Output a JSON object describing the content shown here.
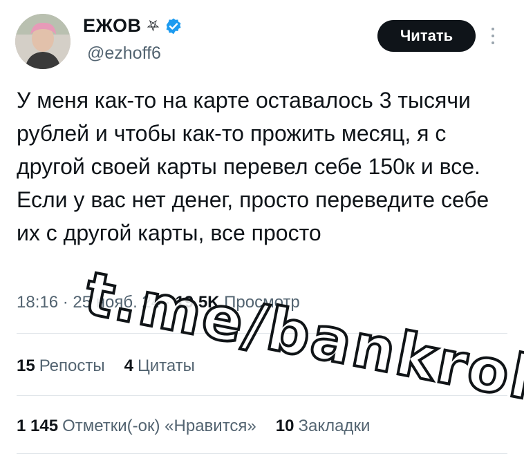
{
  "author": {
    "name": "ЕЖОВ",
    "name_glyph": "⛧",
    "handle": "@ezhoff6"
  },
  "colors": {
    "verified": "#1d9bf0",
    "follow_bg": "#0f1419",
    "muted": "#536471"
  },
  "follow_button": "Читать",
  "tweet": {
    "text": "У меня как-то на карте оставалось 3 тысячи рублей и чтобы как-то прожить месяц, я с другой своей карты перевел себе 150к и все. Если у вас нет денег, просто переведите себе их с другой карты, все просто",
    "time": "18:16 · 25 нояб. 24 · ",
    "views_count": "19,5K",
    "views_label": " Просмотр"
  },
  "stats": {
    "reposts_count": "15",
    "reposts_label": "Репосты",
    "quotes_count": "4",
    "quotes_label": "Цитаты",
    "likes_count": "1 145",
    "likes_label": "Отметки(-ок) «Нравится»",
    "bookmarks_count": "10",
    "bookmarks_label": "Закладки"
  },
  "watermark": "t.me/bankrollo",
  "icons": {
    "verified": "verified-badge-icon",
    "more": "more-vertical-icon"
  }
}
